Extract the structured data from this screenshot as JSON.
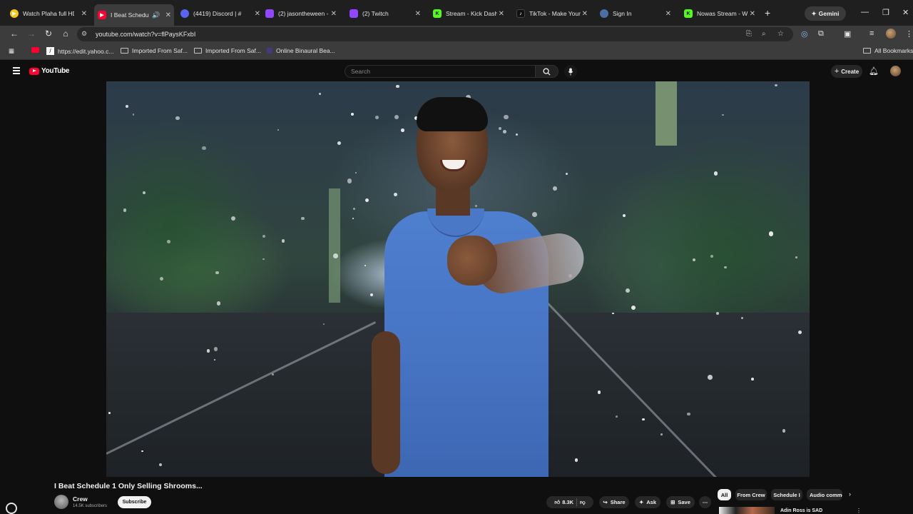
{
  "browser": {
    "tabs": [
      {
        "title": "Watch Plaha full HD",
        "favicon_color": "#f5c518",
        "icon": "play-circle-icon"
      },
      {
        "title": "I Beat Schedule",
        "favicon_color": "#ff0033",
        "icon": "youtube-icon",
        "active": true,
        "audio": true
      },
      {
        "title": "(4419) Discord | #",
        "favicon_color": "#5865f2",
        "icon": "discord-icon"
      },
      {
        "title": "(2) jasontheween -",
        "favicon_color": "#9146ff",
        "icon": "twitch-icon"
      },
      {
        "title": "(2) Twitch",
        "favicon_color": "#9146ff",
        "icon": "twitch-icon"
      },
      {
        "title": "Stream - Kick Dash",
        "favicon_color": "#53fc18",
        "icon": "kick-icon"
      },
      {
        "title": "TikTok - Make Your",
        "favicon_color": "#111111",
        "icon": "tiktok-icon"
      },
      {
        "title": "Sign In",
        "favicon_color": "#4a6fa5",
        "icon": "steam-icon"
      },
      {
        "title": "Nowas Stream - W",
        "favicon_color": "#53fc18",
        "icon": "kick-icon"
      }
    ],
    "gemini_label": "Gemini",
    "url": "youtube.com/watch?v=flPaysKFxbI",
    "bookmarks": [
      {
        "label": "",
        "icon": "youtube-icon"
      },
      {
        "label": "https://edit.yahoo.c...",
        "icon": "yahoo-icon"
      },
      {
        "label": "Imported From Saf...",
        "icon": "folder-icon"
      },
      {
        "label": "Imported From Saf...",
        "icon": "folder-icon"
      },
      {
        "label": "Online Binaural Bea...",
        "icon": "site-icon"
      }
    ],
    "all_bookmarks_label": "All Bookmarks"
  },
  "youtube": {
    "logo_text": "YouTube",
    "search_placeholder": "Search",
    "create_label": "Create",
    "video": {
      "title": "I Beat Schedule 1 Only Selling Shrooms...",
      "channel": "Crew",
      "subscribers": "14.5K subscribers",
      "subscribe_label": "Subscribe",
      "likes": "8.3K",
      "share_label": "Share",
      "ask_label": "Ask",
      "save_label": "Save"
    },
    "chips": [
      "All",
      "From Crew",
      "Schedule I",
      "Audio comme"
    ],
    "recommended": {
      "title": "Adin Ross is SAD"
    }
  },
  "colors": {
    "youtube_red": "#ff0033",
    "page_bg": "#0f0f0f",
    "chrome_bg": "#3c3c3c"
  }
}
